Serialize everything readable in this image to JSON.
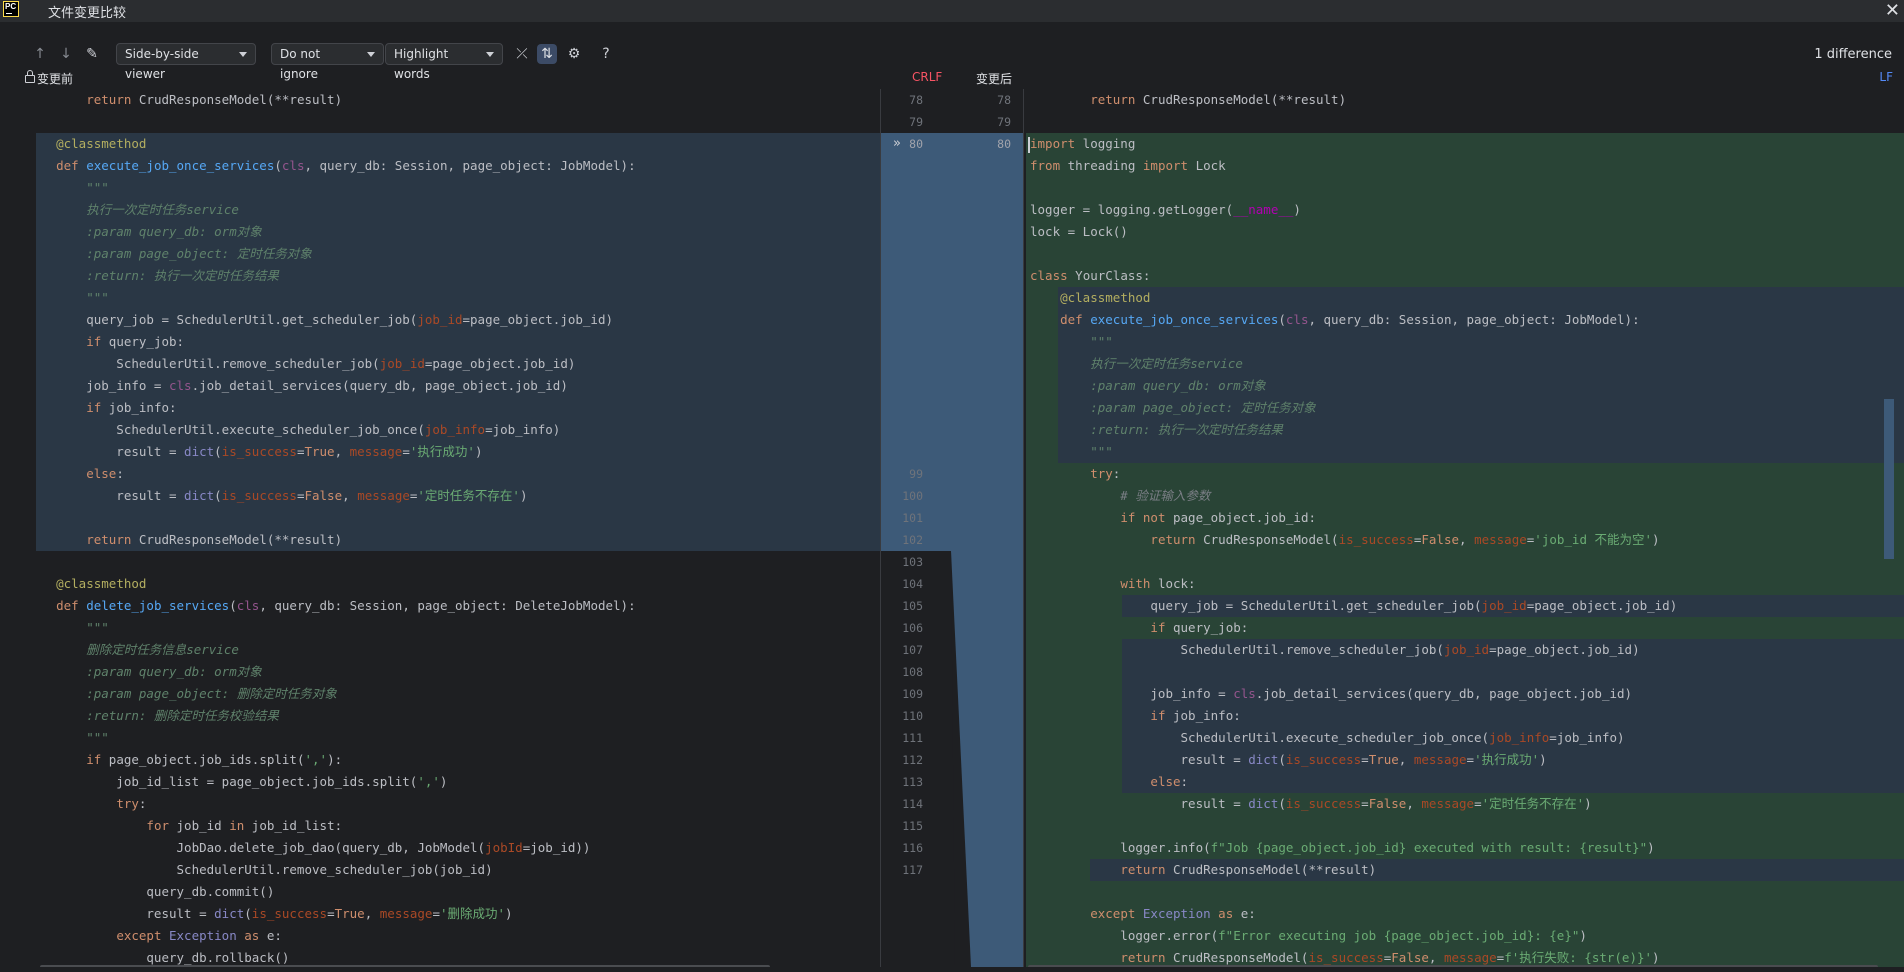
{
  "window": {
    "title": "文件变更比较",
    "app_logo": "PC"
  },
  "toolbar": {
    "viewer_mode": "Side-by-side viewer",
    "ignore_mode": "Do not ignore",
    "highlight_mode": "Highlight words",
    "diff_count": "1 difference",
    "help": "?"
  },
  "header": {
    "left_title": "变更前",
    "left_eol": "CRLF",
    "right_title": "变更后",
    "right_eol": "LF"
  },
  "gutter": {
    "rows": [
      {
        "left": "78",
        "right": "78"
      },
      {
        "left": "79",
        "right": "79"
      },
      {
        "left": "80",
        "right": "80"
      },
      {
        "left": "99",
        "right": ""
      },
      {
        "left": "100",
        "right": ""
      },
      {
        "left": "101",
        "right": ""
      },
      {
        "left": "102",
        "right": ""
      },
      {
        "left": "103",
        "right": ""
      },
      {
        "left": "104",
        "right": ""
      },
      {
        "left": "105",
        "right": ""
      },
      {
        "left": "106",
        "right": ""
      },
      {
        "left": "107",
        "right": ""
      },
      {
        "left": "108",
        "right": ""
      },
      {
        "left": "109",
        "right": ""
      },
      {
        "left": "110",
        "right": ""
      },
      {
        "left": "111",
        "right": ""
      },
      {
        "left": "112",
        "right": ""
      },
      {
        "left": "113",
        "right": ""
      },
      {
        "left": "114",
        "right": ""
      },
      {
        "left": "115",
        "right": ""
      },
      {
        "left": "116",
        "right": ""
      },
      {
        "left": "117",
        "right": ""
      }
    ]
  },
  "left_code": [
    "        return CrudResponseModel(**result)",
    "",
    "    @classmethod",
    "    def execute_job_once_services(cls, query_db: Session, page_object: JobModel):",
    "        \"\"\"",
    "        执行一次定时任务service",
    "        :param query_db: orm对象",
    "        :param page_object: 定时任务对象",
    "        :return: 执行一次定时任务结果",
    "        \"\"\"",
    "        query_job = SchedulerUtil.get_scheduler_job(job_id=page_object.job_id)",
    "        if query_job:",
    "            SchedulerUtil.remove_scheduler_job(job_id=page_object.job_id)",
    "        job_info = cls.job_detail_services(query_db, page_object.job_id)",
    "        if job_info:",
    "            SchedulerUtil.execute_scheduler_job_once(job_info=job_info)",
    "            result = dict(is_success=True, message='执行成功')",
    "        else:",
    "            result = dict(is_success=False, message='定时任务不存在')",
    "",
    "        return CrudResponseModel(**result)",
    "",
    "    @classmethod",
    "    def delete_job_services(cls, query_db: Session, page_object: DeleteJobModel):",
    "        \"\"\"",
    "        删除定时任务信息service",
    "        :param query_db: orm对象",
    "        :param page_object: 删除定时任务对象",
    "        :return: 删除定时任务校验结果",
    "        \"\"\"",
    "        if page_object.job_ids.split(','):",
    "            job_id_list = page_object.job_ids.split(',')",
    "            try:",
    "                for job_id in job_id_list:",
    "                    JobDao.delete_job_dao(query_db, JobModel(jobId=job_id))",
    "                    SchedulerUtil.remove_scheduler_job(job_id)",
    "                query_db.commit()",
    "                result = dict(is_success=True, message='删除成功')",
    "            except Exception as e:",
    "                query_db.rollback()"
  ],
  "right_code": [
    "        return CrudResponseModel(**result)",
    "",
    "import logging",
    "from threading import Lock",
    "",
    "logger = logging.getLogger(__name__)",
    "lock = Lock()",
    "",
    "class YourClass:",
    "    @classmethod",
    "    def execute_job_once_services(cls, query_db: Session, page_object: JobModel):",
    "        \"\"\"",
    "        执行一次定时任务service",
    "        :param query_db: orm对象",
    "        :param page_object: 定时任务对象",
    "        :return: 执行一次定时任务结果",
    "        \"\"\"",
    "        try:",
    "            # 验证输入参数",
    "            if not page_object.job_id:",
    "                return CrudResponseModel(is_success=False, message='job_id 不能为空')",
    "",
    "            with lock:",
    "                query_job = SchedulerUtil.get_scheduler_job(job_id=page_object.job_id)",
    "                if query_job:",
    "                    SchedulerUtil.remove_scheduler_job(job_id=page_object.job_id)",
    "",
    "                job_info = cls.job_detail_services(query_db, page_object.job_id)",
    "                if job_info:",
    "                    SchedulerUtil.execute_scheduler_job_once(job_info=job_info)",
    "                    result = dict(is_success=True, message='执行成功')",
    "                else:",
    "                    result = dict(is_success=False, message='定时任务不存在')",
    "",
    "            logger.info(f\"Job {page_object.job_id} executed with result: {result}\")",
    "            return CrudResponseModel(**result)",
    "",
    "        except Exception as e:",
    "            logger.error(f\"Error executing job {page_object.job_id}: {e}\")",
    "            return CrudResponseModel(is_success=False, message=f'执行失败: {str(e)}')"
  ]
}
